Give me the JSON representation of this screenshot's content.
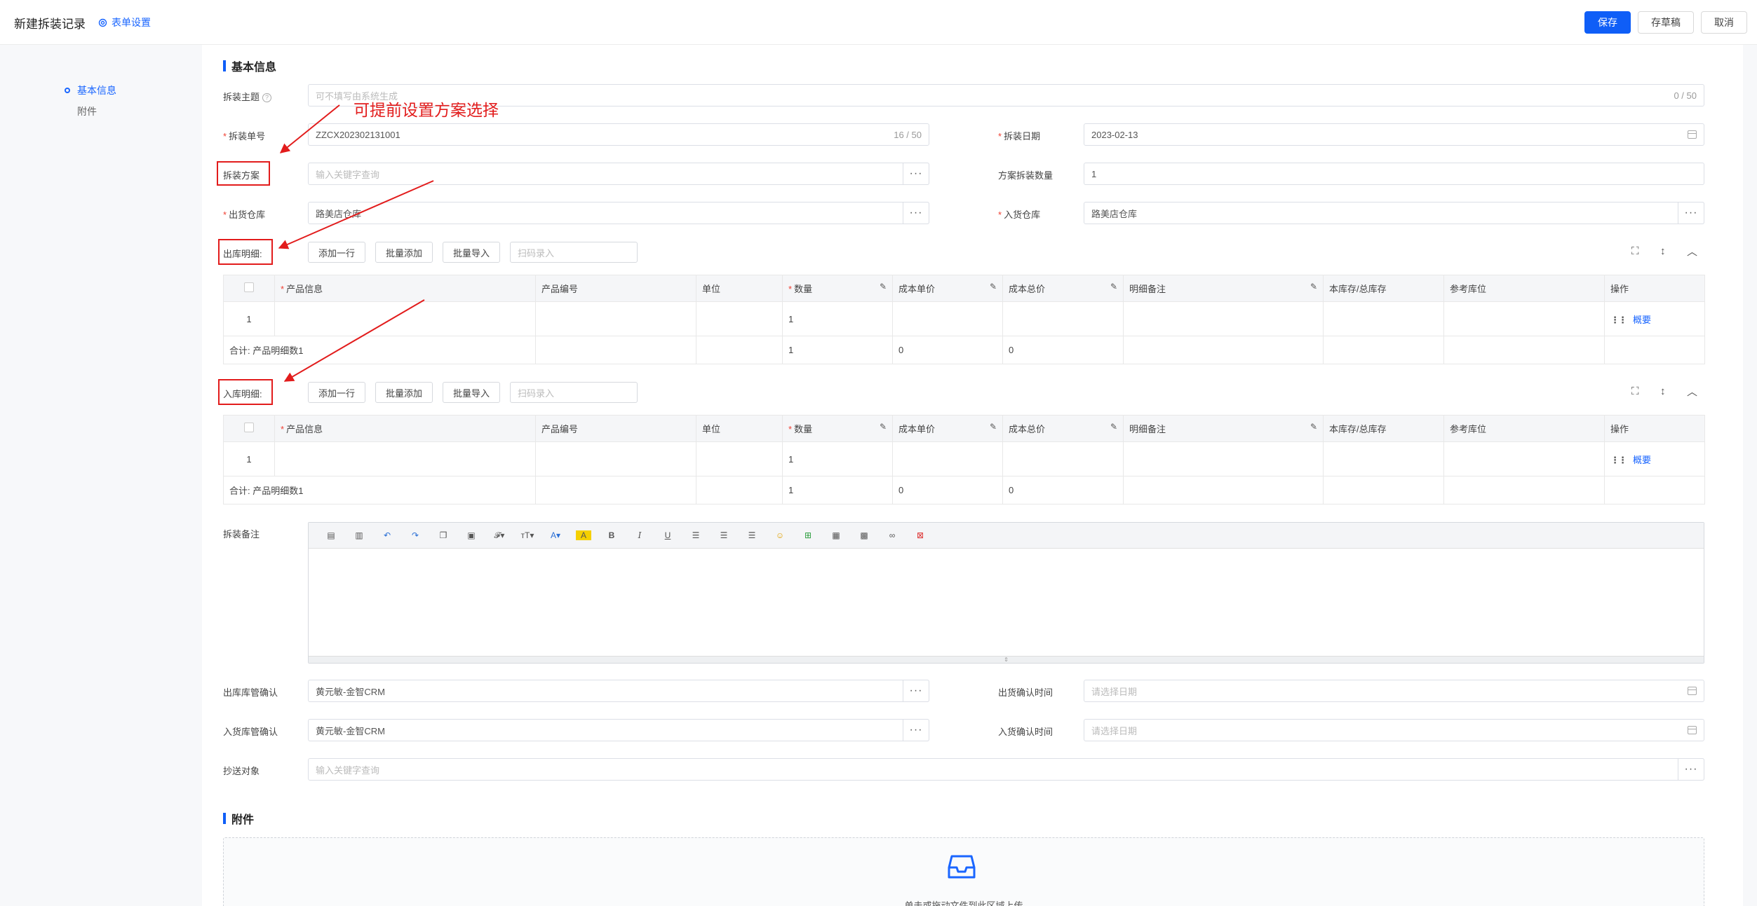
{
  "header": {
    "title": "新建拆装记录",
    "form_settings": "表单设置",
    "save": "保存",
    "draft": "存草稿",
    "cancel": "取消"
  },
  "side_nav": {
    "items": [
      {
        "label": "基本信息",
        "active": true
      },
      {
        "label": "附件",
        "active": false
      }
    ]
  },
  "basic": {
    "section_title": "基本信息",
    "subject": {
      "label": "拆装主题",
      "placeholder": "可不填写由系统生成",
      "count": "0 / 50"
    },
    "order_no": {
      "label": "拆装单号",
      "value": "ZZCX202302131001",
      "count": "16 / 50"
    },
    "date": {
      "label": "拆装日期",
      "value": "2023-02-13"
    },
    "plan": {
      "label": "拆装方案",
      "placeholder": "输入关键字查询"
    },
    "plan_qty": {
      "label": "方案拆装数量",
      "value": "1"
    },
    "out_wh": {
      "label": "出货仓库",
      "value": "路美店仓库"
    },
    "in_wh": {
      "label": "入货仓库",
      "value": "路美店仓库"
    }
  },
  "annotation": "可提前设置方案选择",
  "toolbar": {
    "add_row": "添加一行",
    "batch_add": "批量添加",
    "batch_import": "批量导入",
    "scan_placeholder": "扫码录入"
  },
  "columns": [
    "产品信息",
    "产品编号",
    "单位",
    "数量",
    "成本单价",
    "成本总价",
    "明细备注",
    "本库存/总库存",
    "参考库位",
    "操作"
  ],
  "out_detail": {
    "label": "出库明细:",
    "rows": [
      {
        "index": "1",
        "qty": "1",
        "action": "概要"
      }
    ],
    "total": {
      "label": "合计: 产品明细数1",
      "qty": "1",
      "unit_cost": "0",
      "total_cost": "0"
    }
  },
  "in_detail": {
    "label": "入库明细:",
    "rows": [
      {
        "index": "1",
        "qty": "1",
        "action": "概要"
      }
    ],
    "total": {
      "label": "合计: 产品明细数1",
      "qty": "1",
      "unit_cost": "0",
      "total_cost": "0"
    }
  },
  "remark": {
    "label": "拆装备注"
  },
  "confirm": {
    "out_manager": {
      "label": "出库库管确认",
      "value": "黄元敏-金智CRM"
    },
    "out_time": {
      "label": "出货确认时间",
      "placeholder": "请选择日期"
    },
    "in_manager": {
      "label": "入货库管确认",
      "value": "黄元敏-金智CRM"
    },
    "in_time": {
      "label": "入货确认时间",
      "placeholder": "请选择日期"
    },
    "cc": {
      "label": "抄送对象",
      "placeholder": "输入关键字查询"
    }
  },
  "attachments": {
    "section_title": "附件",
    "upload_hint": "单击或拖动文件到此区域上传"
  },
  "colors": {
    "primary": "#0f5ef7",
    "annotation": "#e21c1c"
  }
}
